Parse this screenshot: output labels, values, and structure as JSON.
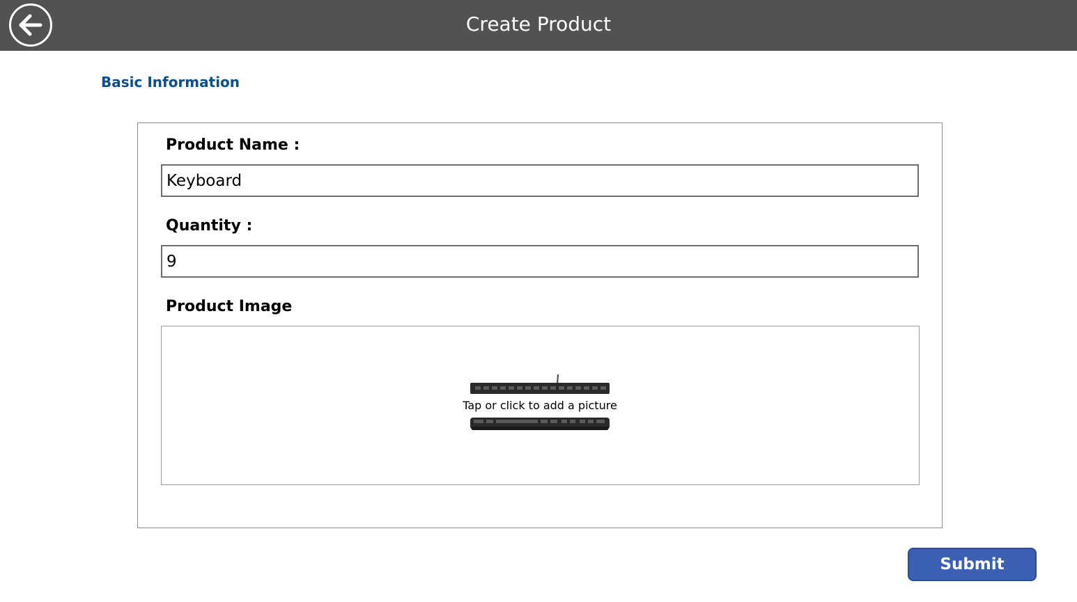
{
  "header": {
    "title": "Create Product",
    "back_icon": "arrow-left-circle-icon"
  },
  "form": {
    "section_title": "Basic Information",
    "product_name": {
      "label": "Product Name :",
      "value": "Keyboard"
    },
    "quantity": {
      "label": "Quantity :",
      "value": "9"
    },
    "product_image": {
      "label": "Product Image",
      "caption": "Tap or click to add a picture",
      "image": "keyboard-photo"
    }
  },
  "actions": {
    "submit_label": "Submit"
  },
  "colors": {
    "header_bg": "#525252",
    "section_title": "#0b4f8a",
    "submit_bg": "#3a5fb3"
  }
}
